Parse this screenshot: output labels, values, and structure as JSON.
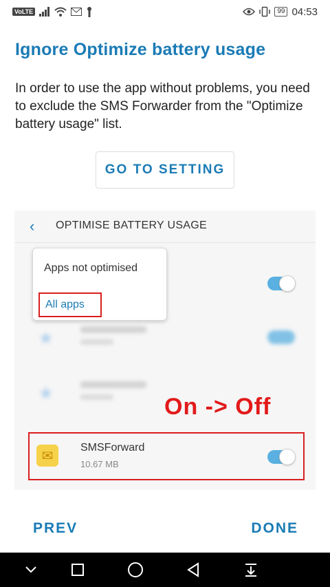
{
  "status_bar": {
    "volte": "VoLTE",
    "battery": "99",
    "time": "04:53",
    "icons": [
      "signal-icon",
      "wifi-icon",
      "gmail-icon",
      "lock-icon",
      "eye-icon",
      "vibrate-icon"
    ]
  },
  "page": {
    "title": "Ignore Optimize battery usage",
    "description": "In order to use the app without problems, you need to exclude the SMS Forwarder from the \"Optimize battery usage\" list.",
    "go_to_setting": "GO TO SETTING"
  },
  "screenshot": {
    "header_title": "OPTIMISE BATTERY USAGE",
    "dropdown": {
      "item1": "Apps not optimised",
      "item2": "All apps"
    },
    "annotation": "On -> Off",
    "app": {
      "name": "SMSForward",
      "size": "10.67 MB",
      "toggle_state": "on"
    },
    "highlight_color": "#d81e1e"
  },
  "footer": {
    "prev": "PREV",
    "done": "DONE"
  },
  "colors": {
    "accent": "#1a7bb5",
    "toggle": "#5ab0e0",
    "annotation": "#e21a1a"
  }
}
